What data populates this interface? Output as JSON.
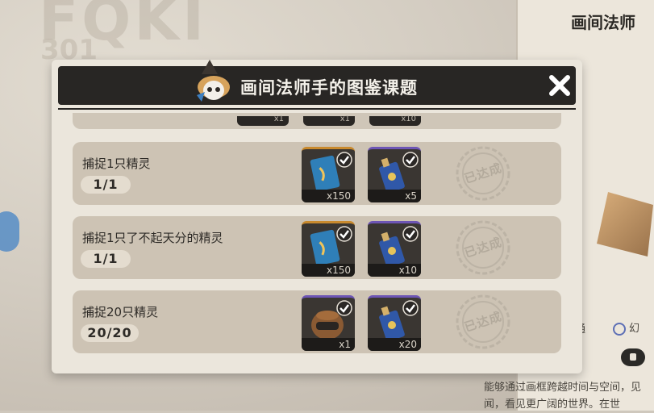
{
  "background": {
    "ghost_title": "FQKI",
    "ghost_number": "301",
    "side_header": "画间法师",
    "side_text": "能够通过画框跨越时间与空间，见闻，看见更广阔的世界。在世",
    "chip_1": "普通",
    "chip_2": "幻"
  },
  "modal": {
    "title": "画间法师手的图鉴课题",
    "close_icon": "close-icon",
    "cutoff_counts": [
      "x1",
      "x1",
      "x10"
    ],
    "tasks": [
      {
        "label": "捕捉1只精灵",
        "progress": "1/1",
        "rewards": [
          {
            "icon": "blue-card-icon",
            "count": "x150",
            "rarity": "gold"
          },
          {
            "icon": "blue-potion-icon",
            "count": "x5",
            "rarity": "purple"
          }
        ],
        "stamp": "已达成"
      },
      {
        "label": "捕捉1只了不起天分的精灵",
        "progress": "1/1",
        "rewards": [
          {
            "icon": "blue-card-icon",
            "count": "x150",
            "rarity": "gold"
          },
          {
            "icon": "blue-potion-icon",
            "count": "x10",
            "rarity": "purple"
          }
        ],
        "stamp": "已达成"
      },
      {
        "label": "捕捉20只精灵",
        "progress": "20/20",
        "rewards": [
          {
            "icon": "brown-helmet-icon",
            "count": "x1",
            "rarity": "purple"
          },
          {
            "icon": "blue-potion-icon",
            "count": "x20",
            "rarity": "purple"
          }
        ],
        "stamp": "已达成"
      }
    ]
  },
  "colors": {
    "header_dark": "#282624",
    "row_bg": "#cdc3b4",
    "gold_rarity": "#c98a2e",
    "purple_rarity": "#6d55b5"
  }
}
